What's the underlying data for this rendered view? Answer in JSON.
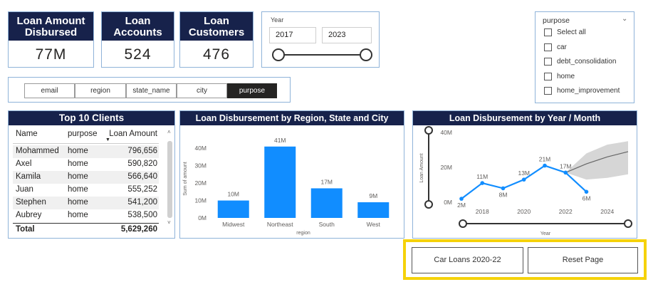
{
  "kpis": [
    {
      "title_line1": "Loan Amount",
      "title_line2": "Disbursed",
      "value": "77M"
    },
    {
      "title_line1": "Loan",
      "title_line2": "Accounts",
      "value": "524"
    },
    {
      "title_line1": "Loan",
      "title_line2": "Customers",
      "value": "476"
    }
  ],
  "year_slicer": {
    "label": "Year",
    "start": "2017",
    "end": "2023"
  },
  "field_buttons": [
    "email",
    "region",
    "state_name",
    "city",
    "purpose"
  ],
  "active_field": "purpose",
  "purpose_slicer": {
    "title": "purpose",
    "items": [
      "Select all",
      "car",
      "debt_consolidation",
      "home",
      "home_improvement"
    ]
  },
  "top_clients": {
    "title": "Top 10 Clients",
    "headers": {
      "name": "Name",
      "purpose": "purpose",
      "amount": "Loan Amount"
    },
    "rows": [
      {
        "name": "Mohammed",
        "purpose": "home",
        "amount": "796,656"
      },
      {
        "name": "Axel",
        "purpose": "home",
        "amount": "590,820"
      },
      {
        "name": "Kamila",
        "purpose": "home",
        "amount": "566,640"
      },
      {
        "name": "Juan",
        "purpose": "home",
        "amount": "555,252"
      },
      {
        "name": "Stephen",
        "purpose": "home",
        "amount": "541,200"
      },
      {
        "name": "Aubrey",
        "purpose": "home",
        "amount": "538,500"
      }
    ],
    "total_label": "Total",
    "total_value": "5,629,260"
  },
  "region_chart": {
    "title": "Loan Disbursement by Region, State and City"
  },
  "year_chart": {
    "title": "Loan Disbursement by Year / Month"
  },
  "buttons": {
    "car_loans": "Car Loans 2020-22",
    "reset": "Reset Page"
  },
  "colors": {
    "header_navy": "#17224b",
    "bar_blue": "#118dff",
    "highlight": "#f5d20a",
    "border": "#8fb3d9"
  },
  "chart_data": [
    {
      "type": "bar",
      "categories": [
        "Midwest",
        "Northeast",
        "South",
        "West"
      ],
      "values": [
        10,
        41,
        17,
        9
      ],
      "data_labels": [
        "10M",
        "41M",
        "17M",
        "9M"
      ],
      "xlabel": "region",
      "ylabel": "Sum of amount",
      "yticks": [
        "0M",
        "10M",
        "20M",
        "30M",
        "40M"
      ],
      "ylim": [
        0,
        45
      ]
    },
    {
      "type": "line",
      "x": [
        2017,
        2018,
        2019,
        2020,
        2021,
        2022,
        2023
      ],
      "values": [
        2,
        11,
        8,
        13,
        21,
        17,
        6
      ],
      "data_labels": [
        "2M",
        "11M",
        "8M",
        "13M",
        "21M",
        "17M",
        "6M"
      ],
      "forecast": {
        "x": [
          2022,
          2023,
          2024,
          2025
        ],
        "values": [
          17,
          22,
          26,
          29
        ],
        "lower": [
          17,
          13,
          14,
          16
        ],
        "upper": [
          17,
          28,
          33,
          35
        ]
      },
      "xlabel": "Year",
      "ylabel": "Loan Amount",
      "xticks": [
        "2018",
        "2020",
        "2022",
        "2024"
      ],
      "yticks": [
        "0M",
        "20M",
        "40M"
      ],
      "ylim": [
        0,
        40
      ]
    }
  ]
}
